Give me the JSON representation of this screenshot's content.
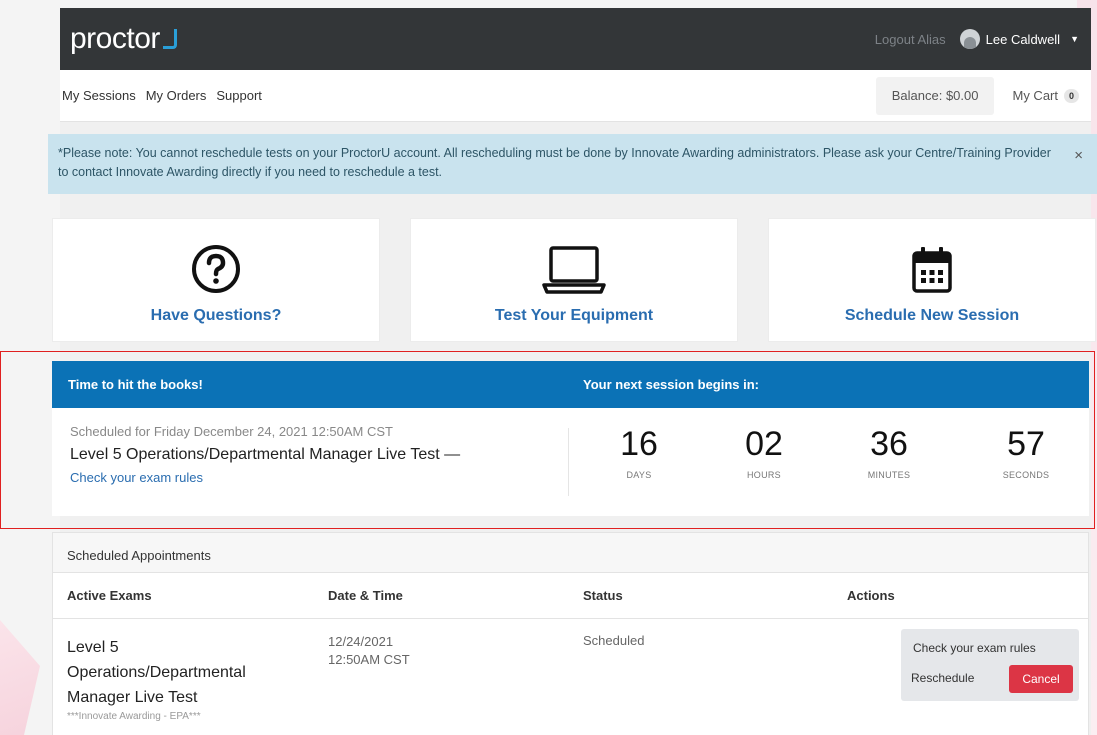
{
  "header": {
    "logo_text": "proctor",
    "logout_alias": "Logout Alias",
    "user_name": "Lee Caldwell"
  },
  "nav": {
    "links": [
      "My Sessions",
      "My Orders",
      "Support"
    ],
    "balance": "Balance: $0.00",
    "cart_label": "My Cart",
    "cart_count": "0"
  },
  "alert": {
    "text": "*Please note: You cannot reschedule tests on your ProctorU account. All rescheduling must be done by Innovate Awarding administrators. Please ask your Centre/Training Provider to contact Innovate Awarding directly if you need to reschedule a test.",
    "close": "×"
  },
  "cards": [
    {
      "label": "Have Questions?",
      "icon": "question-circle-icon"
    },
    {
      "label": "Test Your Equipment",
      "icon": "laptop-icon"
    },
    {
      "label": "Schedule New Session",
      "icon": "calendar-icon"
    }
  ],
  "countdown": {
    "header_left": "Time to hit the books!",
    "header_right": "Your next session begins in:",
    "scheduled": "Scheduled for Friday December 24, 2021 12:50AM CST",
    "title": "Level 5 Operations/Departmental Manager Live Test —",
    "link": "Check your exam rules",
    "units": [
      {
        "value": "16",
        "label": "DAYS"
      },
      {
        "value": "02",
        "label": "HOURS"
      },
      {
        "value": "36",
        "label": "MINUTES"
      },
      {
        "value": "57",
        "label": "SECONDS"
      }
    ]
  },
  "appointments": {
    "heading": "Scheduled Appointments",
    "columns": [
      "Active Exams",
      "Date & Time",
      "Status",
      "Actions"
    ],
    "row": {
      "exam": "Level 5 Operations/Departmental Manager Live Test",
      "exam_sub": "***Innovate Awarding - EPA***",
      "date": "12/24/2021",
      "time": "12:50AM CST",
      "status": "Scheduled",
      "rules_button": "Check your exam rules",
      "reschedule_button": "Reschedule",
      "cancel_button": "Cancel"
    }
  },
  "colors": {
    "topbar": "#333638",
    "brand_blue": "#0b72b6",
    "link_blue": "#2a6db0",
    "alert_bg": "#c9e3ee",
    "cancel_red": "#dc3545",
    "highlight_frame": "#e02020"
  }
}
